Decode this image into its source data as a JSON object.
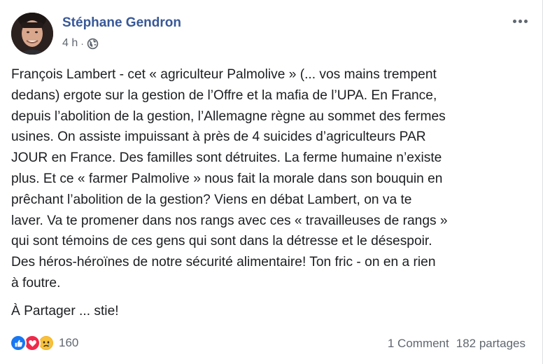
{
  "post": {
    "author": "Stéphane Gendron",
    "time": "4 h",
    "separator": "·",
    "body_lines": [
      "François Lambert - cet « agriculteur Palmolive » (... vos mains trempent",
      "dedans) ergote sur la gestion de l’Offre et la mafia de l’UPA. En France,",
      "depuis l’abolition de la gestion, l’Allemagne règne au sommet des fermes",
      "usines. On assiste impuissant à près de 4 suicides d’agriculteurs PAR",
      "JOUR en France. Des familles sont détruites. La ferme humaine n’existe",
      "plus. Et ce « farmer Palmolive » nous fait la morale dans son bouquin en",
      "prêchant l’abolition de la gestion? Viens en débat Lambert, on va te",
      "laver. Va te promener dans nos rangs avec ces « travailleuses de rangs »",
      "qui sont témoins de ces gens qui sont dans la détresse et le désespoir.",
      "Des héros-héroïnes de notre sécurité alimentaire! Ton fric - on en a rien",
      "à foutre."
    ],
    "share_line": "À Partager ... stie!"
  },
  "footer": {
    "reaction_icons": [
      "like-icon",
      "love-icon",
      "sad-icon"
    ],
    "reaction_count": "160",
    "comments": "1 Comment",
    "shares": "182 partages"
  },
  "colors": {
    "author": "#385898",
    "meta": "#606770",
    "text": "#1c1e21",
    "like": "#1877f2",
    "love": "#f0284a",
    "sad": "#f7b125"
  }
}
